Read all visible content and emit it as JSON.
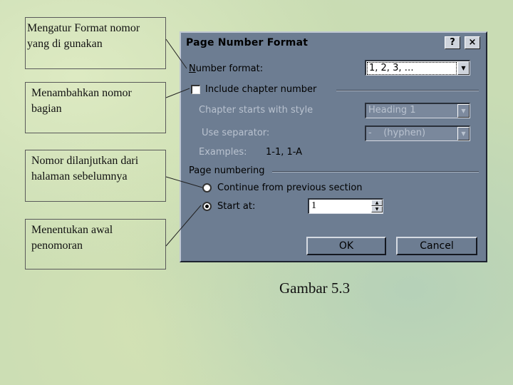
{
  "callouts": {
    "format_line1": "Mengatur Format nomor",
    "format_line2": "yang di gunakan",
    "chapter_line1": "Menambahkan nomor",
    "chapter_line2": "bagian",
    "continue_line1": "Nomor dilanjutkan dari",
    "continue_line2": "halaman sebelumnya",
    "start_line1": "Menentukan awal",
    "start_line2": "penomoran"
  },
  "dialog": {
    "title": "Page Number Format",
    "help_button": "?",
    "close_button": "×",
    "number_format_label": "Number format:",
    "number_format_value": "1, 2, 3, …",
    "include_chapter_label": "Include chapter number",
    "include_chapter_checked": false,
    "chapter_style_label": "Chapter starts with style",
    "chapter_style_value": "Heading 1",
    "separator_label": "Use separator:",
    "separator_value": "-    (hyphen)",
    "examples_label": "Examples:",
    "examples_value": "1-1, 1-A",
    "page_numbering_label": "Page numbering",
    "continue_label": "Continue from previous section",
    "start_at_label": "Start at:",
    "selected_option": "start_at",
    "start_at_value": "1",
    "ok_label": "OK",
    "cancel_label": "Cancel"
  },
  "caption": "Gambar 5.3"
}
